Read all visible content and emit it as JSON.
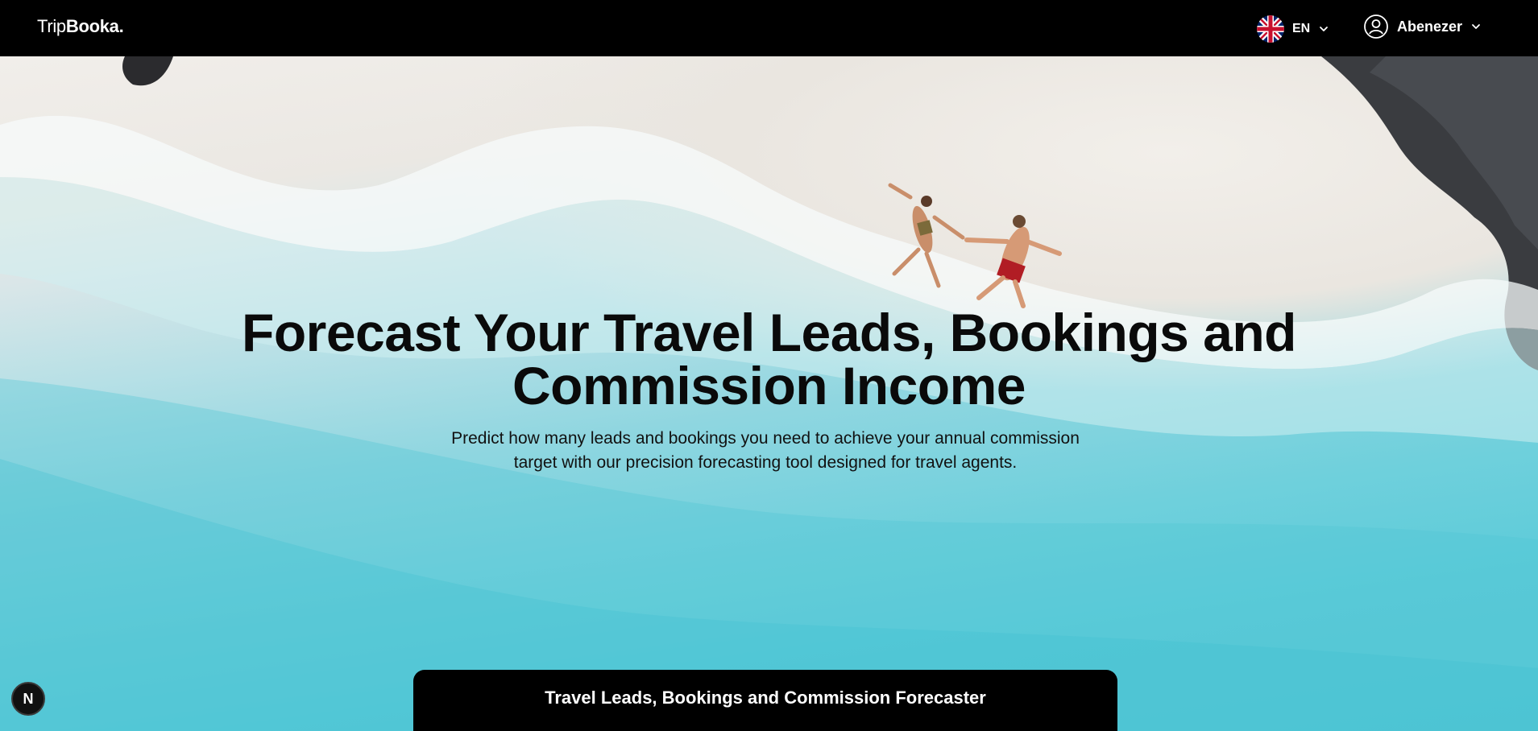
{
  "header": {
    "logo_trip": "Trip",
    "logo_booka": "Booka.",
    "language": "EN",
    "user_name": "Abenezer"
  },
  "hero": {
    "title_line1": "Forecast Your Travel Leads, Bookings and",
    "title_line2": "Commission Income",
    "subtitle_line1": "Predict how many leads and bookings you need to achieve your annual commission",
    "subtitle_line2": "target with our precision forecasting tool designed for travel agents."
  },
  "forecaster": {
    "title": "Travel Leads, Bookings and Commission Forecaster"
  },
  "dev_badge": {
    "label": "N"
  },
  "icons": [
    "uk-flag-icon",
    "chevron-down-icon",
    "user-icon"
  ],
  "colors": {
    "topbar": "#000000",
    "sea": "#5ccbd9",
    "sand": "#ebe8e3",
    "headline": "#0a0a0a"
  }
}
